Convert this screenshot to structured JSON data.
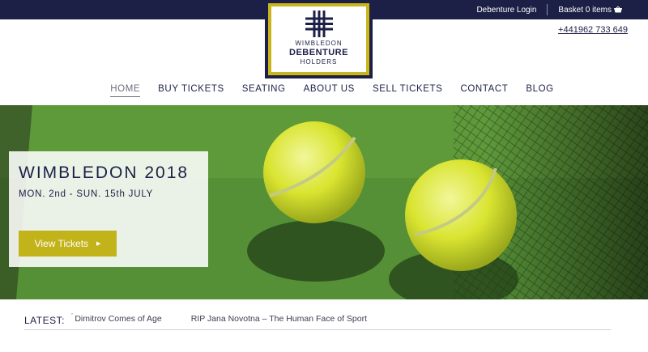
{
  "topbar": {
    "login_label": "Debenture Login",
    "basket_label": "Basket 0 items"
  },
  "logo": {
    "line1": "WIMBLEDON",
    "line2": "DEBENTURE",
    "line3": "HOLDERS"
  },
  "phone": "+441962 733 649",
  "nav": {
    "items": [
      {
        "label": "HOME",
        "active": true
      },
      {
        "label": "BUY TICKETS"
      },
      {
        "label": "SEATING"
      },
      {
        "label": "ABOUT US"
      },
      {
        "label": "SELL TICKETS"
      },
      {
        "label": "CONTACT"
      },
      {
        "label": "BLOG"
      }
    ]
  },
  "hero": {
    "title": "WIMBLEDON 2018",
    "dates": "MON. 2nd - SUN. 15th JULY",
    "button_label": "View Tickets"
  },
  "latest": {
    "label": "LATEST:",
    "items": [
      "Dimitrov Comes of Age",
      "RIP Jana Novotna – The Human Face of Sport"
    ]
  },
  "colors": {
    "navy": "#1c2046",
    "gold": "#c3b31b",
    "grass": "#4e8b33",
    "ball": "#d9e430"
  }
}
